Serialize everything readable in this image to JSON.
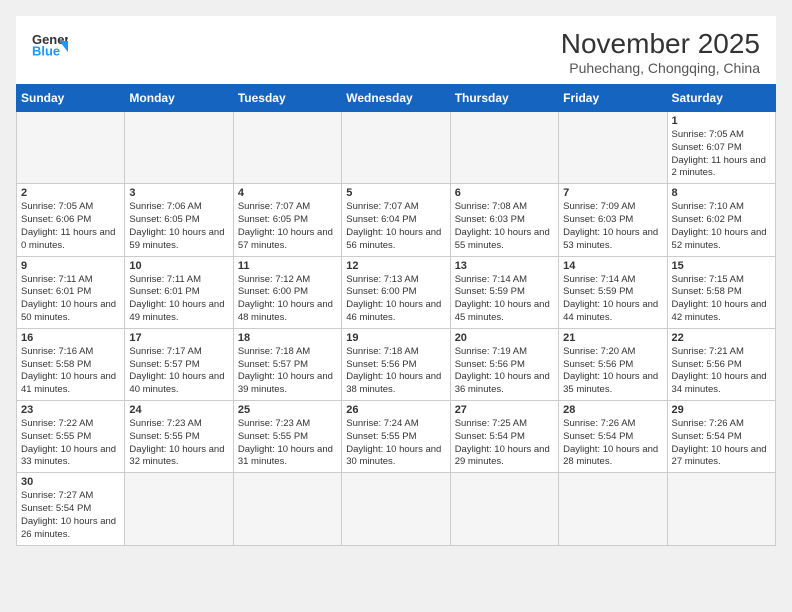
{
  "header": {
    "logo_general": "General",
    "logo_blue": "Blue",
    "month": "November 2025",
    "location": "Puhechang, Chongqing, China"
  },
  "weekdays": [
    "Sunday",
    "Monday",
    "Tuesday",
    "Wednesday",
    "Thursday",
    "Friday",
    "Saturday"
  ],
  "weeks": [
    [
      {
        "num": "",
        "info": ""
      },
      {
        "num": "",
        "info": ""
      },
      {
        "num": "",
        "info": ""
      },
      {
        "num": "",
        "info": ""
      },
      {
        "num": "",
        "info": ""
      },
      {
        "num": "",
        "info": ""
      },
      {
        "num": "1",
        "info": "Sunrise: 7:05 AM\nSunset: 6:07 PM\nDaylight: 11 hours and 2 minutes."
      }
    ],
    [
      {
        "num": "2",
        "info": "Sunrise: 7:05 AM\nSunset: 6:06 PM\nDaylight: 11 hours and 0 minutes."
      },
      {
        "num": "3",
        "info": "Sunrise: 7:06 AM\nSunset: 6:05 PM\nDaylight: 10 hours and 59 minutes."
      },
      {
        "num": "4",
        "info": "Sunrise: 7:07 AM\nSunset: 6:05 PM\nDaylight: 10 hours and 57 minutes."
      },
      {
        "num": "5",
        "info": "Sunrise: 7:07 AM\nSunset: 6:04 PM\nDaylight: 10 hours and 56 minutes."
      },
      {
        "num": "6",
        "info": "Sunrise: 7:08 AM\nSunset: 6:03 PM\nDaylight: 10 hours and 55 minutes."
      },
      {
        "num": "7",
        "info": "Sunrise: 7:09 AM\nSunset: 6:03 PM\nDaylight: 10 hours and 53 minutes."
      },
      {
        "num": "8",
        "info": "Sunrise: 7:10 AM\nSunset: 6:02 PM\nDaylight: 10 hours and 52 minutes."
      }
    ],
    [
      {
        "num": "9",
        "info": "Sunrise: 7:11 AM\nSunset: 6:01 PM\nDaylight: 10 hours and 50 minutes."
      },
      {
        "num": "10",
        "info": "Sunrise: 7:11 AM\nSunset: 6:01 PM\nDaylight: 10 hours and 49 minutes."
      },
      {
        "num": "11",
        "info": "Sunrise: 7:12 AM\nSunset: 6:00 PM\nDaylight: 10 hours and 48 minutes."
      },
      {
        "num": "12",
        "info": "Sunrise: 7:13 AM\nSunset: 6:00 PM\nDaylight: 10 hours and 46 minutes."
      },
      {
        "num": "13",
        "info": "Sunrise: 7:14 AM\nSunset: 5:59 PM\nDaylight: 10 hours and 45 minutes."
      },
      {
        "num": "14",
        "info": "Sunrise: 7:14 AM\nSunset: 5:59 PM\nDaylight: 10 hours and 44 minutes."
      },
      {
        "num": "15",
        "info": "Sunrise: 7:15 AM\nSunset: 5:58 PM\nDaylight: 10 hours and 42 minutes."
      }
    ],
    [
      {
        "num": "16",
        "info": "Sunrise: 7:16 AM\nSunset: 5:58 PM\nDaylight: 10 hours and 41 minutes."
      },
      {
        "num": "17",
        "info": "Sunrise: 7:17 AM\nSunset: 5:57 PM\nDaylight: 10 hours and 40 minutes."
      },
      {
        "num": "18",
        "info": "Sunrise: 7:18 AM\nSunset: 5:57 PM\nDaylight: 10 hours and 39 minutes."
      },
      {
        "num": "19",
        "info": "Sunrise: 7:18 AM\nSunset: 5:56 PM\nDaylight: 10 hours and 38 minutes."
      },
      {
        "num": "20",
        "info": "Sunrise: 7:19 AM\nSunset: 5:56 PM\nDaylight: 10 hours and 36 minutes."
      },
      {
        "num": "21",
        "info": "Sunrise: 7:20 AM\nSunset: 5:56 PM\nDaylight: 10 hours and 35 minutes."
      },
      {
        "num": "22",
        "info": "Sunrise: 7:21 AM\nSunset: 5:56 PM\nDaylight: 10 hours and 34 minutes."
      }
    ],
    [
      {
        "num": "23",
        "info": "Sunrise: 7:22 AM\nSunset: 5:55 PM\nDaylight: 10 hours and 33 minutes."
      },
      {
        "num": "24",
        "info": "Sunrise: 7:23 AM\nSunset: 5:55 PM\nDaylight: 10 hours and 32 minutes."
      },
      {
        "num": "25",
        "info": "Sunrise: 7:23 AM\nSunset: 5:55 PM\nDaylight: 10 hours and 31 minutes."
      },
      {
        "num": "26",
        "info": "Sunrise: 7:24 AM\nSunset: 5:55 PM\nDaylight: 10 hours and 30 minutes."
      },
      {
        "num": "27",
        "info": "Sunrise: 7:25 AM\nSunset: 5:54 PM\nDaylight: 10 hours and 29 minutes."
      },
      {
        "num": "28",
        "info": "Sunrise: 7:26 AM\nSunset: 5:54 PM\nDaylight: 10 hours and 28 minutes."
      },
      {
        "num": "29",
        "info": "Sunrise: 7:26 AM\nSunset: 5:54 PM\nDaylight: 10 hours and 27 minutes."
      }
    ],
    [
      {
        "num": "30",
        "info": "Sunrise: 7:27 AM\nSunset: 5:54 PM\nDaylight: 10 hours and 26 minutes."
      },
      {
        "num": "",
        "info": ""
      },
      {
        "num": "",
        "info": ""
      },
      {
        "num": "",
        "info": ""
      },
      {
        "num": "",
        "info": ""
      },
      {
        "num": "",
        "info": ""
      },
      {
        "num": "",
        "info": ""
      }
    ]
  ]
}
